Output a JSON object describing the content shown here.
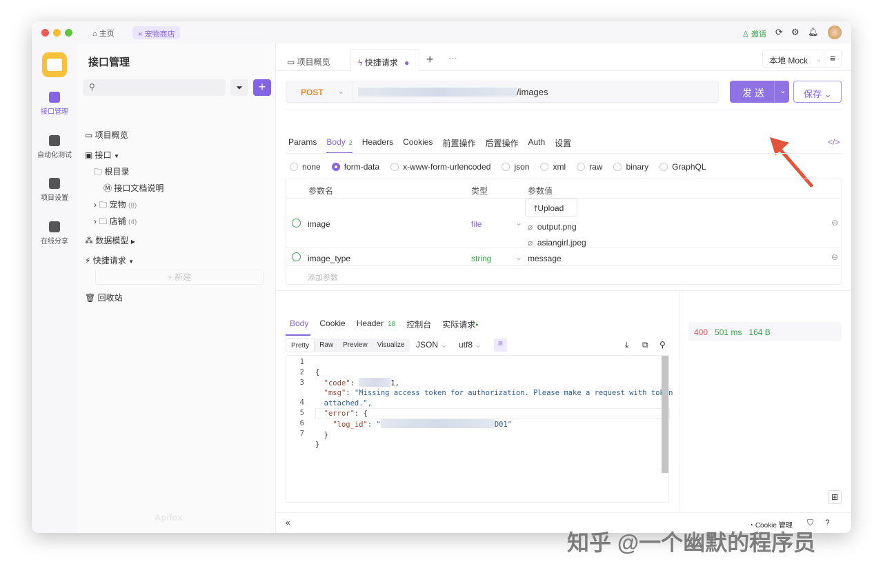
{
  "titlebar": {
    "home_tab": "主页",
    "project_tab": "宠物商店",
    "invite": "邀请"
  },
  "rail": {
    "items": [
      {
        "label": "接口管理",
        "active": true
      },
      {
        "label": "自动化测试"
      },
      {
        "label": "项目设置"
      },
      {
        "label": "在线分享"
      }
    ]
  },
  "sidebar": {
    "title": "接口管理",
    "search_placeholder": "",
    "overview": "项目概览",
    "api": "接口",
    "root": "根目录",
    "doc": "接口文档说明",
    "pets": "宠物",
    "pets_count": "(8)",
    "shops": "店铺",
    "shops_count": "(4)",
    "models": "数据模型",
    "quick": "快捷请求",
    "new": "+ 新建",
    "trash": "回收站",
    "logo": "Apifox"
  },
  "tabs": {
    "overview": "项目概览",
    "quick": "快捷请求",
    "env": "本地 Mock"
  },
  "request": {
    "method": "POST",
    "url_suffix": "/images",
    "send": "发 送",
    "save": "保存"
  },
  "req_tabs": [
    {
      "label": "Params"
    },
    {
      "label": "Body",
      "badge": "2",
      "active": true
    },
    {
      "label": "Headers"
    },
    {
      "label": "Cookies"
    },
    {
      "label": "前置操作"
    },
    {
      "label": "后置操作"
    },
    {
      "label": "Auth"
    },
    {
      "label": "设置"
    }
  ],
  "body_types": [
    {
      "label": "none"
    },
    {
      "label": "form-data",
      "selected": true
    },
    {
      "label": "x-www-form-urlencoded"
    },
    {
      "label": "json"
    },
    {
      "label": "xml"
    },
    {
      "label": "raw"
    },
    {
      "label": "binary"
    },
    {
      "label": "GraphQL"
    }
  ],
  "params": {
    "headers": [
      "参数名",
      "类型",
      "参数值"
    ],
    "upload": "Upload",
    "rows": [
      {
        "name": "image",
        "type": "file",
        "files": [
          "output.png",
          "asiangirl.jpeg"
        ]
      },
      {
        "name": "image_type",
        "type": "string",
        "value": "message"
      }
    ],
    "add": "添加参数"
  },
  "resp_tabs": [
    {
      "label": "Body",
      "active": true
    },
    {
      "label": "Cookie"
    },
    {
      "label": "Header",
      "badge": "18"
    },
    {
      "label": "控制台"
    },
    {
      "label": "实际请求"
    }
  ],
  "resp_views": [
    "Pretty",
    "Raw",
    "Preview",
    "Visualize"
  ],
  "resp_format": "JSON",
  "resp_encoding": "utf8",
  "code_lines": [
    {
      "n": "1"
    },
    {
      "n": "2"
    },
    {
      "n": "3"
    },
    {
      "n": ""
    },
    {
      "n": "4"
    },
    {
      "n": "5"
    },
    {
      "n": "6"
    },
    {
      "n": "7"
    }
  ],
  "code": {
    "l1": "{",
    "code_key": "\"code\"",
    "code_tail": "1,",
    "msg_key": "\"msg\"",
    "msg_val": "\"Missing access token for authorization. Please make a request with token",
    "msg_val2": "attached.\",",
    "err_key": "\"error\"",
    "err_open": ": {",
    "log_key": "\"log_id\"",
    "log_head": ": \"",
    "log_tail": "D01\"",
    "close1": "}",
    "close2": "}"
  },
  "status": {
    "code": "400",
    "time": "501 ms",
    "size": "164 B"
  },
  "footer": {
    "cookie": "Cookie 管理"
  },
  "watermark": "知乎 @一个幽默的程序员",
  "colors": {
    "accent": "#8464e0",
    "post": "#e38b2a",
    "error": "#e0555a",
    "ok": "#3aa14a"
  }
}
